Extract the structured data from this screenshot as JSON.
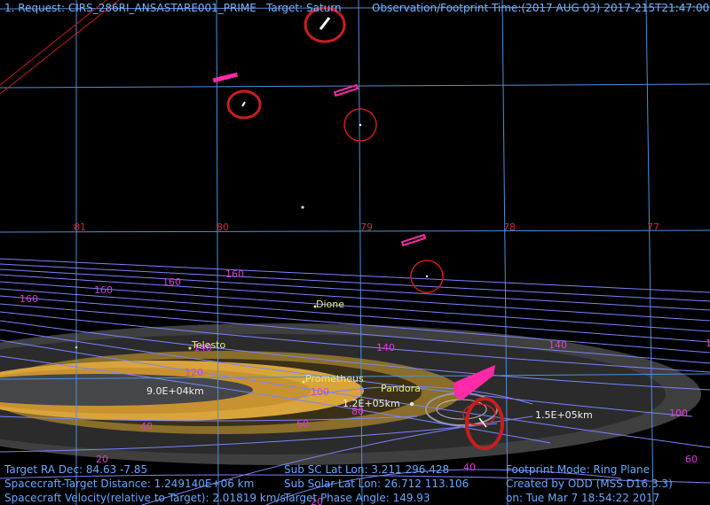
{
  "header": {
    "request": "1. Request: CIRS_286RI_ANSASTARE001_PRIME",
    "target": "Target: Saturn",
    "time": "Observation/Footprint Time:(2017 AUG 03) 2017-215T21:47:00.00"
  },
  "info": {
    "ra_dec": "Target RA Dec: 84.63 -7.85",
    "distance": "Spacecraft-Target Distance: 1.249140E+06 km",
    "velocity": "Spacecraft Velocity(relative to Target): 2.01819 km/s",
    "sub_sc": "Sub SC Lat Lon: 3.211 296.428",
    "sub_solar": "Sub Solar Lat Lon: 26.712 113.106",
    "phase": "Target Phase Angle: 149.93",
    "mode": "Footprint Mode: Ring Plane",
    "created": "Created by ODD (MSS D16.3.3)",
    "date": "on: Tue Mar 7 18:54:22 2017"
  },
  "grid_labels": [
    "81",
    "80",
    "79",
    "78",
    "77"
  ],
  "contour_labels": {
    "l160a": "160",
    "l160b": "160",
    "l160c": "160",
    "l160d": "160",
    "l140a": "140",
    "l140b": "140",
    "l140c": "140",
    "l140d": "1",
    "l120": "120",
    "l100a": "100",
    "l100b": "100",
    "l80": "80",
    "l60a": "60",
    "l60b": "60",
    "l40a": "40",
    "l40b": "40",
    "l20a": "20",
    "l20b": "20"
  },
  "moons": [
    "Telesto",
    "Dione",
    "Prometheus",
    "Pandora"
  ],
  "distance_labels": [
    "9.0E+04km",
    "1.2E+05km",
    "1.5E+05km"
  ],
  "colors": {
    "grid": "#4f8fd8",
    "contour": "#7a84ff",
    "label": "#d63fd6",
    "footprint": "#c81e1e",
    "magenta": "#ff2aa8",
    "ring": "#d9a43a",
    "moon": "#e8f06a",
    "header": "#79b4ff"
  }
}
